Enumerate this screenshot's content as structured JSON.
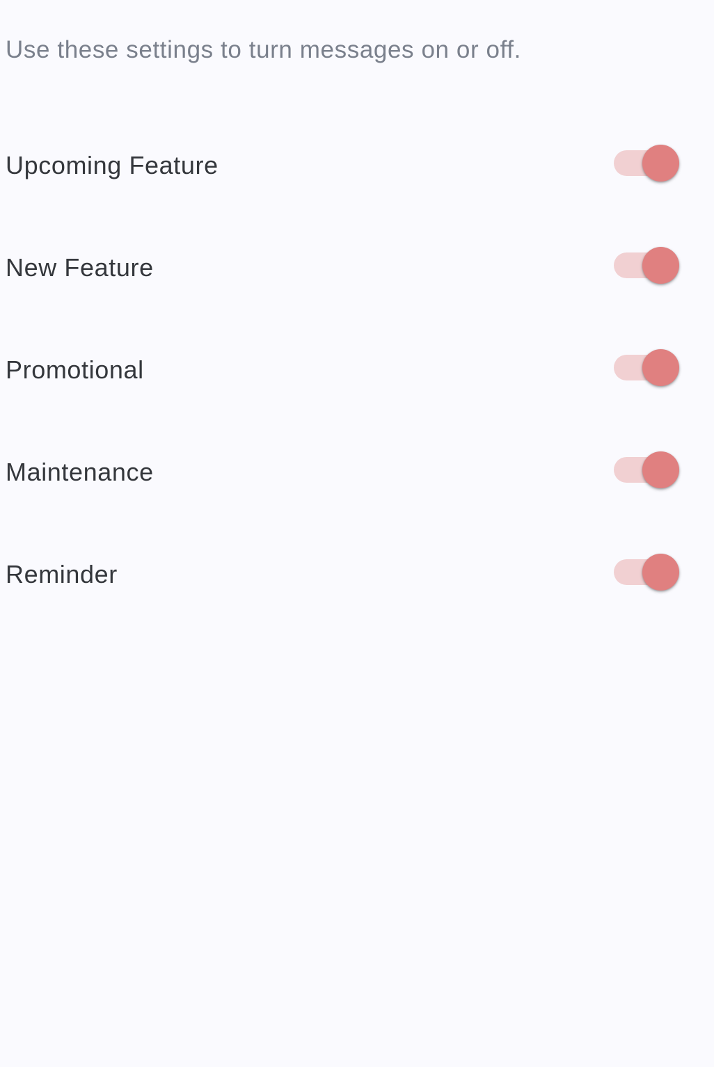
{
  "description": "Use these settings to turn messages on or off.",
  "colors": {
    "background": "#fafafe",
    "accent": "#e08080",
    "accent_track": "#f1d0d2",
    "label_text": "#34373c",
    "description_text": "#7a808c"
  },
  "settings": [
    {
      "label": "Upcoming Feature",
      "enabled": true
    },
    {
      "label": "New Feature",
      "enabled": true
    },
    {
      "label": "Promotional",
      "enabled": true
    },
    {
      "label": "Maintenance",
      "enabled": true
    },
    {
      "label": "Reminder",
      "enabled": true
    }
  ]
}
